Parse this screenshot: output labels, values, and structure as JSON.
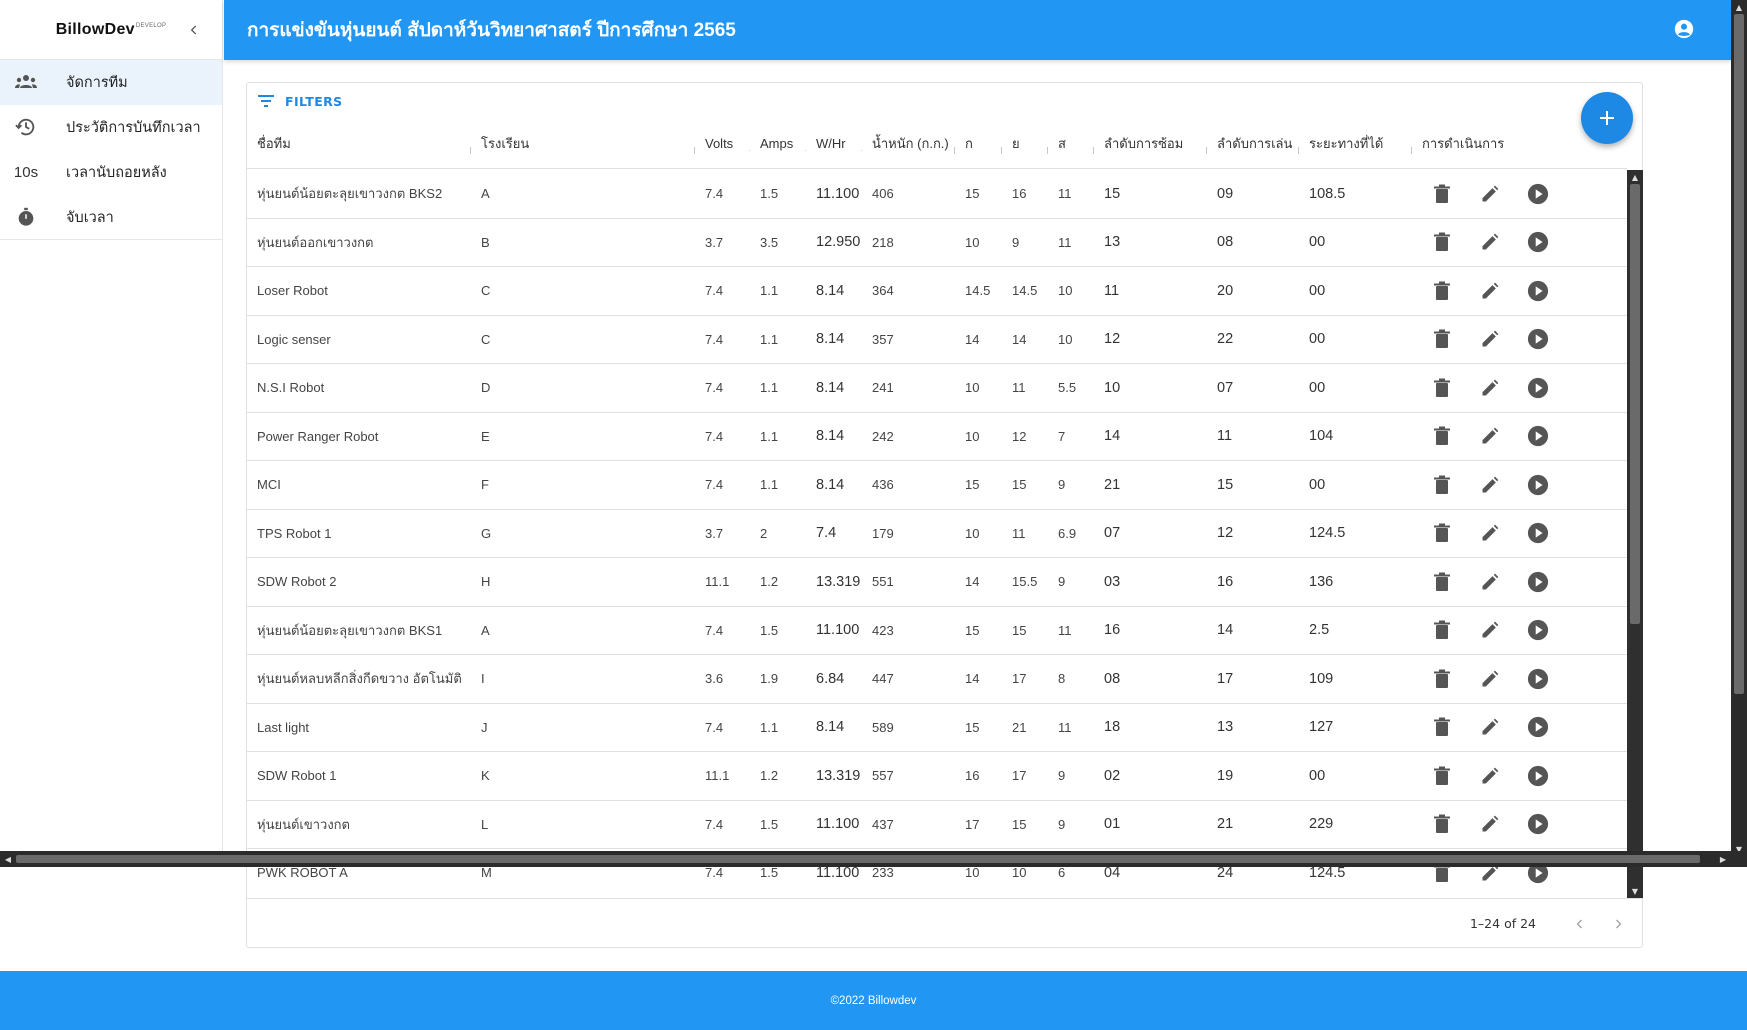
{
  "sidebar": {
    "brand": "BillowDev",
    "brand_tag": "DEVELOP",
    "collapse_icon": "chevron-left-icon",
    "items": [
      {
        "label": "จัดการทีม",
        "icon": "people-icon",
        "active": true
      },
      {
        "label": "ประวัติการบันทึกเวลา",
        "icon": "history-icon",
        "active": false
      },
      {
        "label": "เวลานับถอยหลัง",
        "icon": "countdown-icon",
        "icon_text": "10s",
        "active": false
      },
      {
        "label": "จับเวลา",
        "icon": "stopwatch-icon",
        "active": false
      }
    ]
  },
  "header": {
    "title": "การแข่งขันหุ่นยนต์ สัปดาห์วันวิทยาศาสตร์ ปีการศึกษา 2565",
    "account_icon": "account-circle-icon",
    "color": "#2196f3"
  },
  "toolbar": {
    "filters_label": "FILTERS",
    "add_icon": "plus-icon"
  },
  "table": {
    "columns": [
      "ชื่อทีม",
      "โรงเรียน",
      "Volts",
      "Amps",
      "W/Hr",
      "น้ำหนัก (ก.ก.)",
      "ก",
      "ย",
      "ส",
      "ลำดับการซ้อม",
      "ลำดับการเล่น",
      "ระยะทางที่ได้",
      "การดำเนินการ"
    ],
    "rows": [
      [
        "หุ่นยนต์น้อยตะลุยเขาวงกต BKS2",
        "A",
        "7.4",
        "1.5",
        "11.100",
        "406",
        "15",
        "16",
        "11",
        "15",
        "09",
        "108.5"
      ],
      [
        "หุ่นยนต์ออกเขาวงกต",
        "B",
        "3.7",
        "3.5",
        "12.950",
        "218",
        "10",
        "9",
        "11",
        "13",
        "08",
        "00"
      ],
      [
        "Loser Robot",
        "C",
        "7.4",
        "1.1",
        "8.14",
        "364",
        "14.5",
        "14.5",
        "10",
        "11",
        "20",
        "00"
      ],
      [
        "Logic senser",
        "C",
        "7.4",
        "1.1",
        "8.14",
        "357",
        "14",
        "14",
        "10",
        "12",
        "22",
        "00"
      ],
      [
        "N.S.I Robot",
        "D",
        "7.4",
        "1.1",
        "8.14",
        "241",
        "10",
        "11",
        "5.5",
        "10",
        "07",
        "00"
      ],
      [
        "Power Ranger Robot",
        "E",
        "7.4",
        "1.1",
        "8.14",
        "242",
        "10",
        "12",
        "7",
        "14",
        "11",
        "104"
      ],
      [
        "MCI",
        "F",
        "7.4",
        "1.1",
        "8.14",
        "436",
        "15",
        "15",
        "9",
        "21",
        "15",
        "00"
      ],
      [
        "TPS Robot 1",
        "G",
        "3.7",
        "2",
        "7.4",
        "179",
        "10",
        "11",
        "6.9",
        "07",
        "12",
        "124.5"
      ],
      [
        "SDW Robot 2",
        "H",
        "11.1",
        "1.2",
        "13.319",
        "551",
        "14",
        "15.5",
        "9",
        "03",
        "16",
        "136"
      ],
      [
        "หุ่นยนต์น้อยตะลุยเขาวงกต BKS1",
        "A",
        "7.4",
        "1.5",
        "11.100",
        "423",
        "15",
        "15",
        "11",
        "16",
        "14",
        "2.5"
      ],
      [
        "หุ่นยนต์หลบหลีกสิ่งกีดขวาง อัตโนมัติ",
        "I",
        "3.6",
        "1.9",
        "6.84",
        "447",
        "14",
        "17",
        "8",
        "08",
        "17",
        "109"
      ],
      [
        "Last light",
        "J",
        "7.4",
        "1.1",
        "8.14",
        "589",
        "15",
        "21",
        "11",
        "18",
        "13",
        "127"
      ],
      [
        "SDW Robot 1",
        "K",
        "11.1",
        "1.2",
        "13.319",
        "557",
        "16",
        "17",
        "9",
        "02",
        "19",
        "00"
      ],
      [
        "หุ่นยนต์เขาวงกต",
        "L",
        "7.4",
        "1.5",
        "11.100",
        "437",
        "17",
        "15",
        "9",
        "01",
        "21",
        "229"
      ],
      [
        "PWK ROBOT A",
        "M",
        "7.4",
        "1.5",
        "11.100",
        "233",
        "10",
        "10",
        "6",
        "04",
        "24",
        "124.5"
      ]
    ],
    "row_actions": [
      "delete-icon",
      "edit-icon",
      "play-icon"
    ]
  },
  "pagination": {
    "range": "1–24 of 24",
    "prev_icon": "chevron-left-icon",
    "next_icon": "chevron-right-icon"
  },
  "footer": {
    "text": "©2022 Billowdev"
  }
}
